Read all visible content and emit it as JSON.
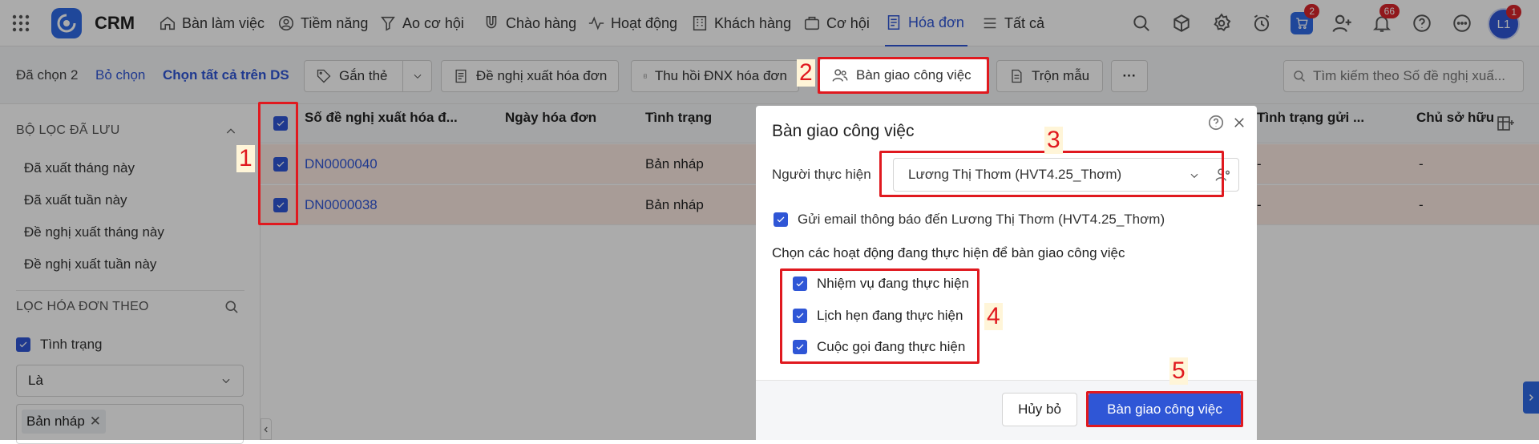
{
  "nav": {
    "app_name": "CRM",
    "items": [
      {
        "label": "Bàn làm việc",
        "icon": "home-icon"
      },
      {
        "label": "Tiềm năng",
        "icon": "user-circle-icon"
      },
      {
        "label": "Ao cơ hội",
        "icon": "funnel-icon"
      },
      {
        "label": "Chào hàng",
        "icon": "magnet-icon"
      },
      {
        "label": "Hoạt động",
        "icon": "activity-icon"
      },
      {
        "label": "Khách hàng",
        "icon": "building-icon"
      },
      {
        "label": "Cơ hội",
        "icon": "briefcase-icon"
      },
      {
        "label": "Hóa đơn",
        "icon": "invoice-icon",
        "active": true
      },
      {
        "label": "Tất cả",
        "icon": "menu-icon"
      }
    ],
    "badges": {
      "cart": "2",
      "notifications": "66",
      "avatar": "1"
    },
    "avatar_initials": "L1"
  },
  "toolbar": {
    "selected": "Đã chọn 2",
    "deselect": "Bỏ chọn",
    "select_all": "Chọn tất cả trên DS",
    "tag": "Gắn thẻ",
    "propose_invoice": "Đề nghị xuất hóa đơn",
    "recall": "Thu hồi ĐNX hóa đơn",
    "handover": "Bàn giao công việc",
    "merge": "Trộn mẫu",
    "more": "···",
    "search_placeholder": "Tìm kiếm theo Số đề nghị xuấ..."
  },
  "sidebar": {
    "saved_filters_title": "BỘ LỌC ĐÃ LƯU",
    "saved_filters": [
      "Đã xuất tháng này",
      "Đã xuất tuần này",
      "Đề nghị xuất tháng này",
      "Đề nghị xuất tuần này"
    ],
    "filter_by_title": "LỌC HÓA ĐƠN THEO",
    "filter_field": "Tình trạng",
    "operator": "Là",
    "chip": "Bản nháp"
  },
  "table": {
    "columns": [
      "Số đề nghị xuất hóa đ...",
      "Ngày hóa đơn",
      "Tình trạng",
      "Tình trạng gửi ...",
      "Chủ sở hữu"
    ],
    "rows": [
      {
        "id": "DN0000040",
        "status": "Bản nháp",
        "send_status": "-",
        "owner": "-"
      },
      {
        "id": "DN0000038",
        "status": "Bản nháp",
        "send_status": "-",
        "owner": "-"
      }
    ]
  },
  "dialog": {
    "title": "Bàn giao công việc",
    "assignee_label": "Người thực hiện",
    "assignee_value": "Lương Thị Thơm (HVT4.25_Thơm)",
    "email_notify": "Gửi email thông báo đến Lương Thị Thơm (HVT4.25_Thơm)",
    "activities_label": "Chọn các hoạt động đang thực hiện để bàn giao công việc",
    "activities": [
      "Nhiệm vụ đang thực hiện",
      "Lịch hẹn đang thực hiện",
      "Cuộc gọi đang thực hiện"
    ],
    "cancel": "Hủy bỏ",
    "submit": "Bàn giao công việc"
  },
  "annotations": [
    "1",
    "2",
    "3",
    "4",
    "5"
  ],
  "colors": {
    "accent": "#2f56d6",
    "annotation": "#e0191f",
    "row_highlight": "#fbe9e1"
  }
}
